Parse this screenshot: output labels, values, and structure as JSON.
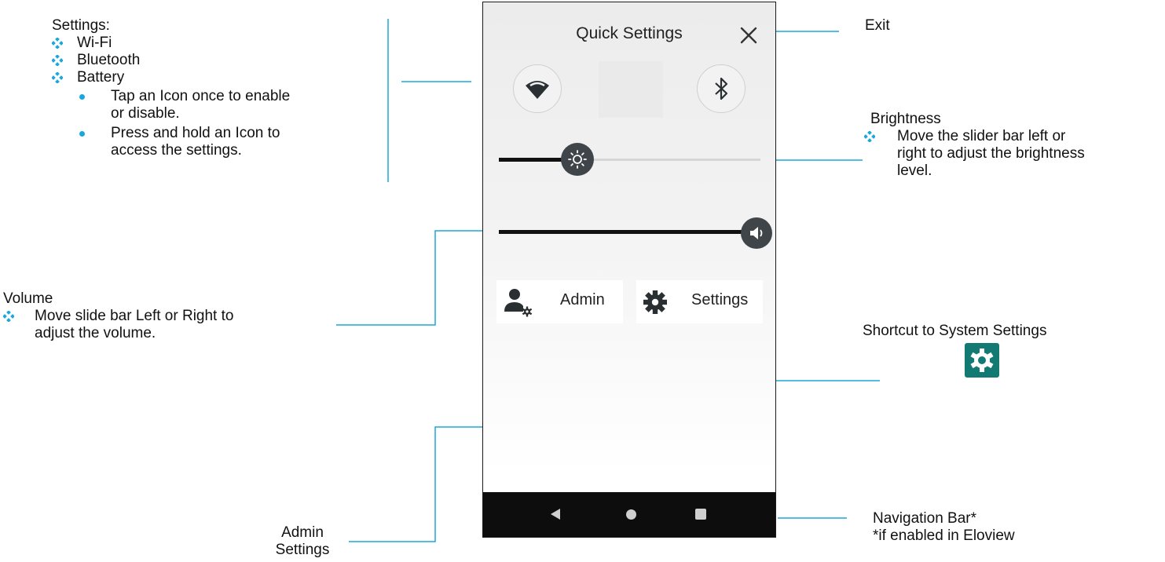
{
  "settings_callout": {
    "heading": "Settings:",
    "items": [
      "Wi-Fi",
      "Bluetooth",
      "Battery"
    ],
    "bullets": [
      "Tap an Icon once to enable",
      "or disable.",
      "Press and hold an Icon to",
      "access the settings."
    ]
  },
  "exit_callout": {
    "label": "Exit"
  },
  "brightness_callout": {
    "heading": "Brightness",
    "lines": [
      "Move the slider bar left or",
      "right to adjust the brightness",
      "level."
    ]
  },
  "volume_callout": {
    "heading": "Volume",
    "lines": [
      "Move slide bar Left or Right to",
      "adjust the volume."
    ]
  },
  "system_settings_callout": {
    "label": "Shortcut to System Settings"
  },
  "navbar_callout": {
    "line1": "Navigation Bar*",
    "line2": "*if enabled in Eloview"
  },
  "admin_callout": {
    "line1": "Admin",
    "line2": "Settings"
  },
  "phone": {
    "title": "Quick Settings",
    "admin_label": "Admin",
    "settings_label": "Settings",
    "brightness_level": 0.3,
    "volume_level": 1.0
  },
  "colors": {
    "leader": "#1ba7dc",
    "bullet": "#1ba7dc",
    "knob": "#3f4548",
    "badge": "#137a73",
    "navbar": "#0d0d0d"
  }
}
